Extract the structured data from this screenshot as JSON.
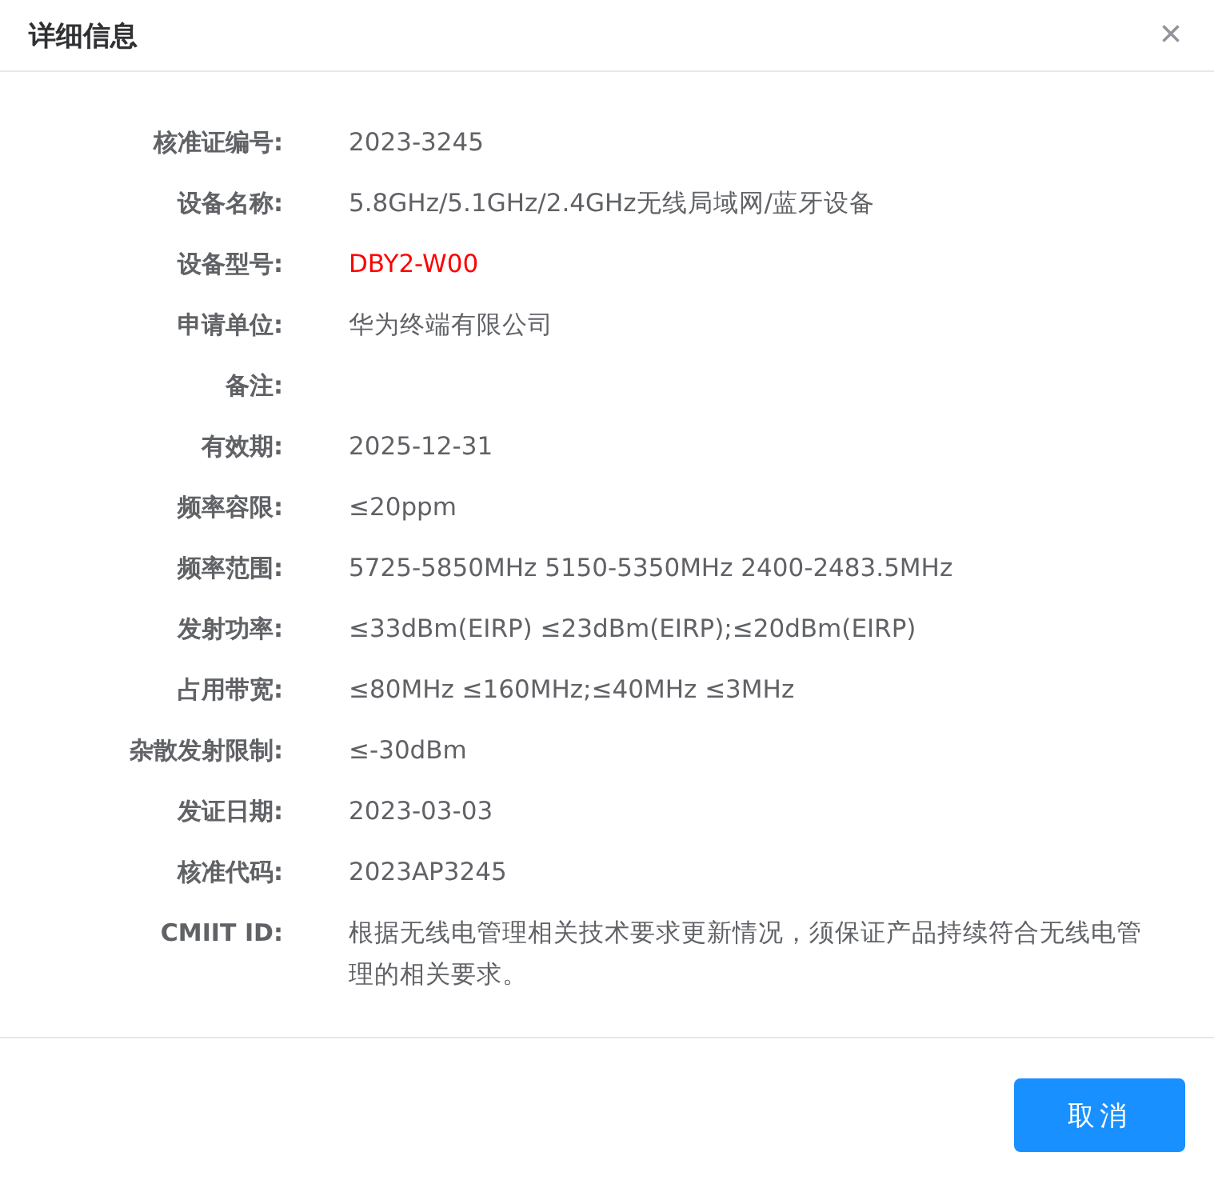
{
  "dialog": {
    "title": "详细信息",
    "close": "×"
  },
  "fields": [
    {
      "label": "核准证编号:",
      "value": "2023-3245",
      "highlighted": false
    },
    {
      "label": "设备名称:",
      "value": "5.8GHz/5.1GHz/2.4GHz无线局域网/蓝牙设备",
      "highlighted": false
    },
    {
      "label": "设备型号:",
      "value": "DBY2-W00",
      "highlighted": true
    },
    {
      "label": "申请单位:",
      "value": "华为终端有限公司",
      "highlighted": false
    },
    {
      "label": "备注:"
    },
    {
      "label": "有效期:",
      "value": "2025-12-31",
      "highlighted": false
    },
    {
      "label": "频率容限:",
      "value": "≤20ppm",
      "highlighted": false
    },
    {
      "label": "频率范围:",
      "value": "5725-5850MHz 5150-5350MHz 2400-2483.5MHz",
      "highlighted": false
    },
    {
      "label": "发射功率:",
      "value": "≤33dBm(EIRP) ≤23dBm(EIRP);≤20dBm(EIRP)",
      "highlighted": false
    },
    {
      "label": "占用带宽:",
      "value": "≤80MHz ≤160MHz;≤40MHz ≤3MHz",
      "highlighted": false
    },
    {
      "label": "杂散发射限制:",
      "value": "≤-30dBm",
      "highlighted": false
    },
    {
      "label": "发证日期:",
      "value": "2023-03-03",
      "highlighted": false
    },
    {
      "label": "核准代码:",
      "value": "2023AP3245",
      "highlighted": false
    },
    {
      "label": "CMIIT ID:",
      "value": "根据无线电管理相关技术要求更新情况，须保证产品持续符合无线电管理的相关要求。",
      "highlighted": false
    }
  ],
  "buttons": [
    "取消"
  ]
}
